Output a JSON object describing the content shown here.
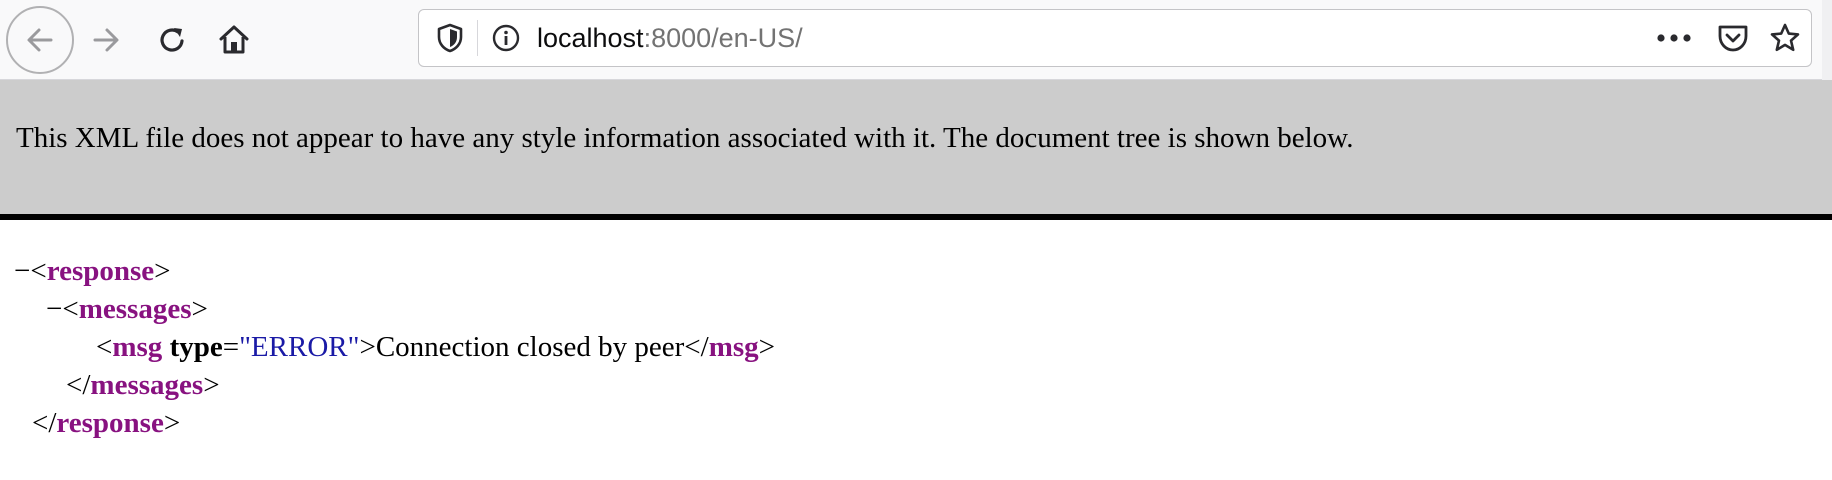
{
  "toolbar": {
    "back_icon": "arrow-left-icon",
    "forward_icon": "arrow-right-icon",
    "reload_icon": "reload-icon",
    "home_icon": "home-icon"
  },
  "urlbar": {
    "host": "localhost",
    "rest": ":8000/en-US/",
    "icons": [
      "shield-icon",
      "info-icon",
      "meatball-menu-icon",
      "pocket-icon",
      "star-icon"
    ]
  },
  "xml_viewer": {
    "header_text": "This XML file does not appear to have any style information associated with it. The document tree is shown below.",
    "tree": {
      "collapse_marker": "−",
      "response_tag": "response",
      "messages_tag": "messages",
      "msg_tag": "msg",
      "msg_attr_name": "type",
      "msg_attr_value": "\"ERROR\"",
      "msg_text": "Connection closed by peer"
    }
  },
  "colors": {
    "tag": "#881280",
    "attr_value": "#1a1aa6",
    "header_bg": "#cccccc"
  }
}
